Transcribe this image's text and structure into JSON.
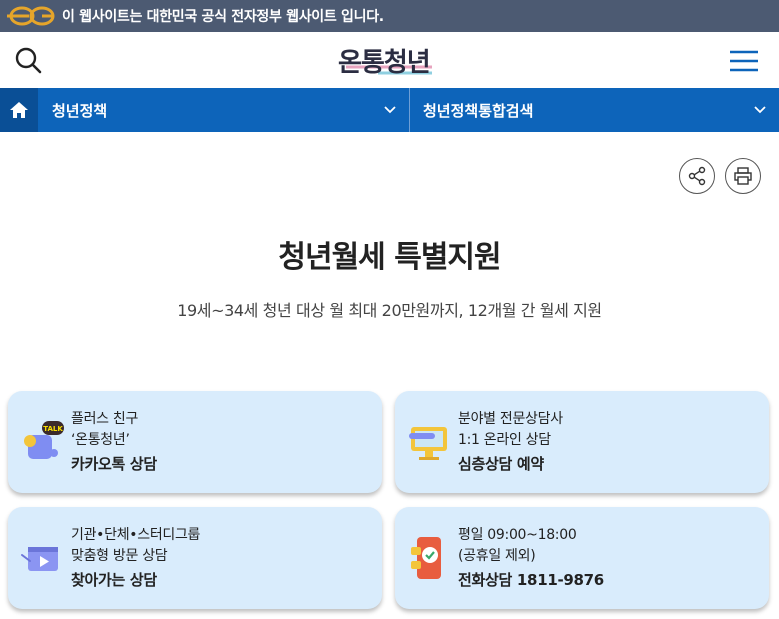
{
  "gov_banner": {
    "text": "이 웹사이트는 대한민국 공식 전자정부 웹사이트 입니다.",
    "logo": "eg-logo"
  },
  "header": {
    "logo_text": "온통청년",
    "search_icon": "search-icon",
    "menu_icon": "hamburger-menu-icon"
  },
  "nav": {
    "home_icon": "home-icon",
    "items": [
      {
        "label": "청년정책"
      },
      {
        "label": "청년정책통합검색"
      }
    ]
  },
  "tools": {
    "share_icon": "share-icon",
    "print_icon": "print-icon"
  },
  "page": {
    "title": "청년월세 특별지원",
    "subtitle": "19세~34세 청년 대상 월 최대 20만원까지, 12개월 간 월세 지원"
  },
  "cards": [
    {
      "line1": "플러스 친구",
      "line2": "‘온통청년’",
      "action": "카카오톡 상담",
      "icon": "kakaotalk-icon"
    },
    {
      "line1": "분야별 전문상담사",
      "line2": "1:1 온라인 상담",
      "action": "심층상담 예약",
      "icon": "monitor-chat-icon"
    },
    {
      "line1": "기관•단체•스터디그룹",
      "line2": "맞춤형 방문 상담",
      "action": "찾아가는 상담",
      "icon": "video-icon"
    },
    {
      "line1": "평일 09:00~18:00",
      "line2": "(공휴일 제외)",
      "action": "전화상담 1811-9876",
      "icon": "phone-icon"
    }
  ],
  "colors": {
    "gov_bar": "#4c5a72",
    "nav": "#0d64ba",
    "nav_home": "#0a4f96",
    "card_bg": "#d9ecfc"
  }
}
